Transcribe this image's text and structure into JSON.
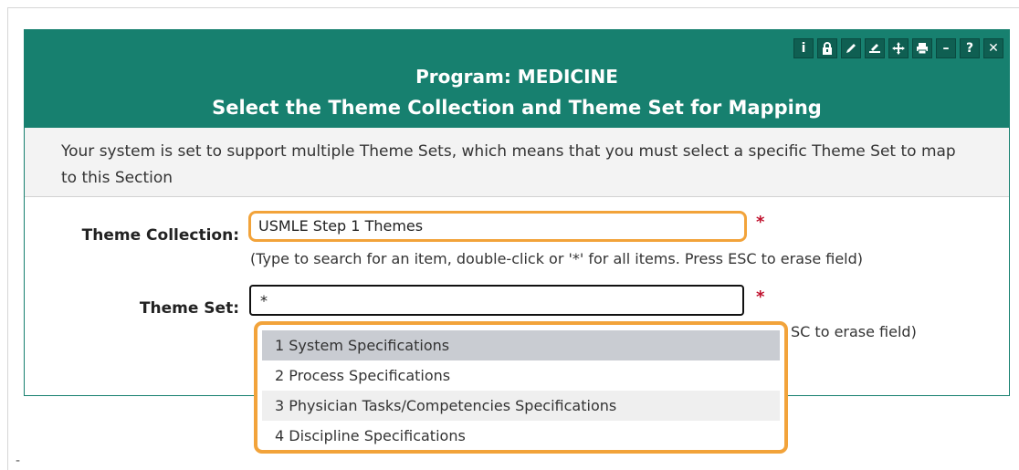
{
  "header": {
    "program_title": "Program: MEDICINE",
    "subtitle": "Select the Theme Collection and Theme Set for Mapping",
    "toolbar": [
      {
        "icon": "info-icon",
        "glyph": "i"
      },
      {
        "icon": "lock-icon",
        "glyph": ""
      },
      {
        "icon": "pencil-icon",
        "glyph": ""
      },
      {
        "icon": "edit-document-icon",
        "glyph": ""
      },
      {
        "icon": "move-icon",
        "glyph": ""
      },
      {
        "icon": "print-icon",
        "glyph": ""
      },
      {
        "icon": "minimize-icon",
        "glyph": "–"
      },
      {
        "icon": "help-icon",
        "glyph": "?"
      },
      {
        "icon": "close-icon",
        "glyph": "✕"
      }
    ]
  },
  "info": {
    "message": "Your system is set to support multiple Theme Sets, which means that you must select a specific Theme Set to map to this Section"
  },
  "form": {
    "theme_collection": {
      "label": "Theme Collection:",
      "value": "USMLE Step 1 Themes",
      "required_mark": "*",
      "hint": "(Type to search for an item, double-click or '*' for all items. Press ESC to erase field)"
    },
    "theme_set": {
      "label": "Theme Set:",
      "value": "*",
      "required_mark": "*",
      "hint_visible": "SC to erase field)"
    }
  },
  "dropdown": {
    "options": [
      "1 System Specifications",
      "2 Process Specifications",
      "3 Physician Tasks/Competencies Specifications",
      "4 Discipline Specifications"
    ],
    "selected_index": 0
  },
  "colors": {
    "header_bg": "#17806f",
    "highlight_border": "#f2a33a",
    "required": "#c0112d",
    "selected_option_bg": "#c9ccd2"
  }
}
